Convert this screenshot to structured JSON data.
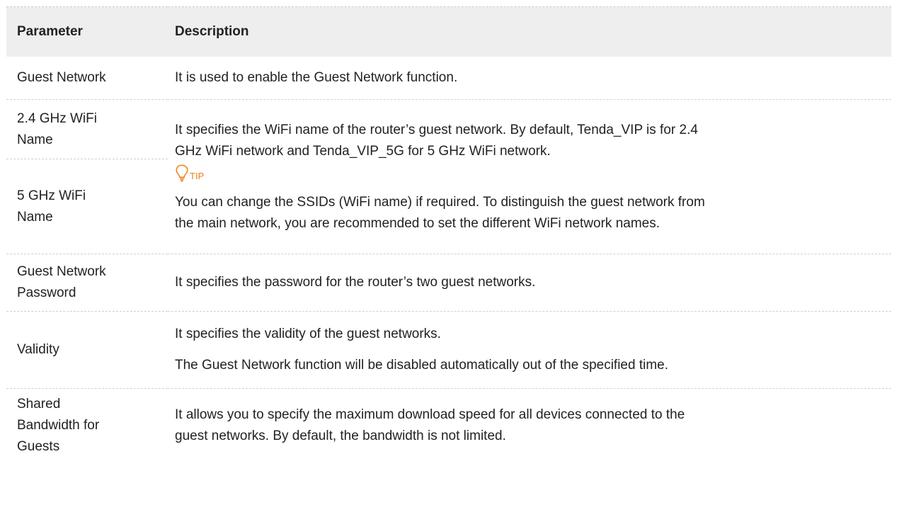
{
  "table": {
    "headers": {
      "parameter": "Parameter",
      "description": "Description"
    },
    "rows": {
      "guest_network": {
        "name": "Guest Network",
        "description": "It is used to enable the Guest Network function."
      },
      "wifi_24": {
        "name_line1": "2.4 GHz WiFi",
        "name_line2": "Name",
        "description_line1": "It specifies the WiFi name of the router’s guest network. By default, Tenda_VIP is for 2.4",
        "description_line2": "GHz WiFi network and Tenda_VIP_5G for 5 GHz WiFi network."
      },
      "wifi_5": {
        "name_line1": "5 GHz WiFi",
        "name_line2": "Name"
      },
      "tip": {
        "icon": "lightbulb-icon",
        "label": "TIP",
        "color": "#f07d17",
        "line1": "You can change the SSIDs (WiFi name) if required. To distinguish the guest network from",
        "line2": "the main network, you are recommended to set the different WiFi network names."
      },
      "guest_password": {
        "name_line1": "Guest Network",
        "name_line2": "Password",
        "description": "It specifies the password for the router’s two guest networks."
      },
      "validity": {
        "name": "Validity",
        "description_line1": "It specifies the validity of the guest networks.",
        "description_line2": "The Guest Network function will be disabled automatically out of the specified time."
      },
      "shared_bandwidth": {
        "name_line1": "Shared",
        "name_line2": "Bandwidth for",
        "name_line3": "Guests",
        "description_line1": "It allows you to specify the maximum download speed for all devices connected to the",
        "description_line2": "guest networks. By default, the bandwidth is not limited."
      }
    }
  }
}
